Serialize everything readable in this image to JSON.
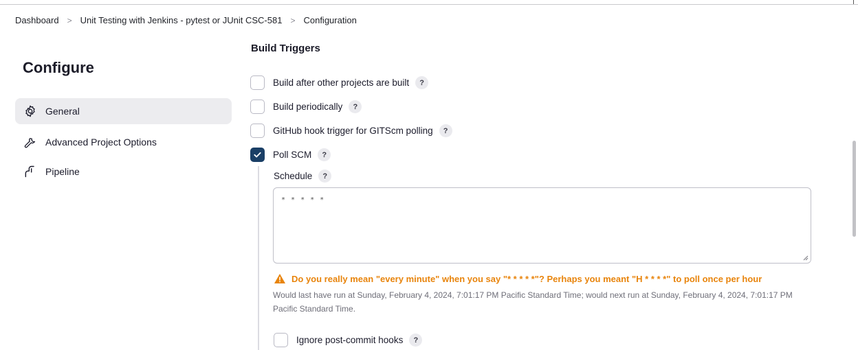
{
  "breadcrumb": {
    "items": [
      "Dashboard",
      "Unit Testing with Jenkins - pytest or JUnit CSC-581",
      "Configuration"
    ],
    "separator": ">"
  },
  "sidebar": {
    "title": "Configure",
    "items": [
      {
        "label": "General",
        "icon": "gear-icon",
        "active": true
      },
      {
        "label": "Advanced Project Options",
        "icon": "wrench-icon",
        "active": false
      },
      {
        "label": "Pipeline",
        "icon": "pipeline-icon",
        "active": false
      }
    ]
  },
  "main": {
    "section_title": "Build Triggers",
    "triggers": [
      {
        "label": "Build after other projects are built",
        "checked": false
      },
      {
        "label": "Build periodically",
        "checked": false
      },
      {
        "label": "GitHub hook trigger for GITScm polling",
        "checked": false
      },
      {
        "label": "Poll SCM",
        "checked": true
      }
    ],
    "help_glyph": "?",
    "schedule": {
      "label": "Schedule",
      "value": "* * * * *"
    },
    "warning": "Do you really mean \"every minute\" when you say \"* * * * *\"? Perhaps you meant \"H * * * *\" to poll once per hour",
    "info": "Would last have run at Sunday, February 4, 2024, 7:01:17 PM Pacific Standard Time; would next run at Sunday, February 4, 2024, 7:01:17 PM Pacific Standard Time.",
    "ignore_hooks": {
      "label": "Ignore post-commit hooks",
      "checked": false
    }
  },
  "colors": {
    "checked": "#1a3f66",
    "warning": "#e8840c",
    "active_bg": "#ececef"
  }
}
